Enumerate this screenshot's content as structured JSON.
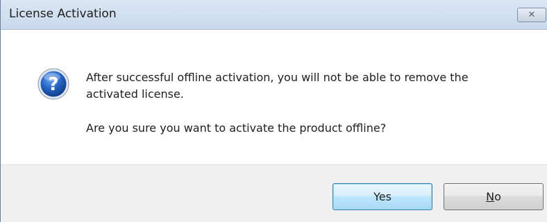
{
  "window": {
    "title": "License Activation",
    "close_glyph": "✕"
  },
  "message": {
    "icon": "question-icon",
    "line1": "After successful offline activation, you will not be able to remove the",
    "line2": "activated license.",
    "question": "Are you sure you want to activate the product offline?"
  },
  "buttons": {
    "yes_label": "Yes",
    "no_mnemonic": "N",
    "no_rest": "o"
  },
  "colors": {
    "titlebar": "#c9d9ec",
    "footer": "#f0f0f0",
    "default_button_border": "#3c7fb1",
    "icon_blue": "#1f5fb8"
  }
}
